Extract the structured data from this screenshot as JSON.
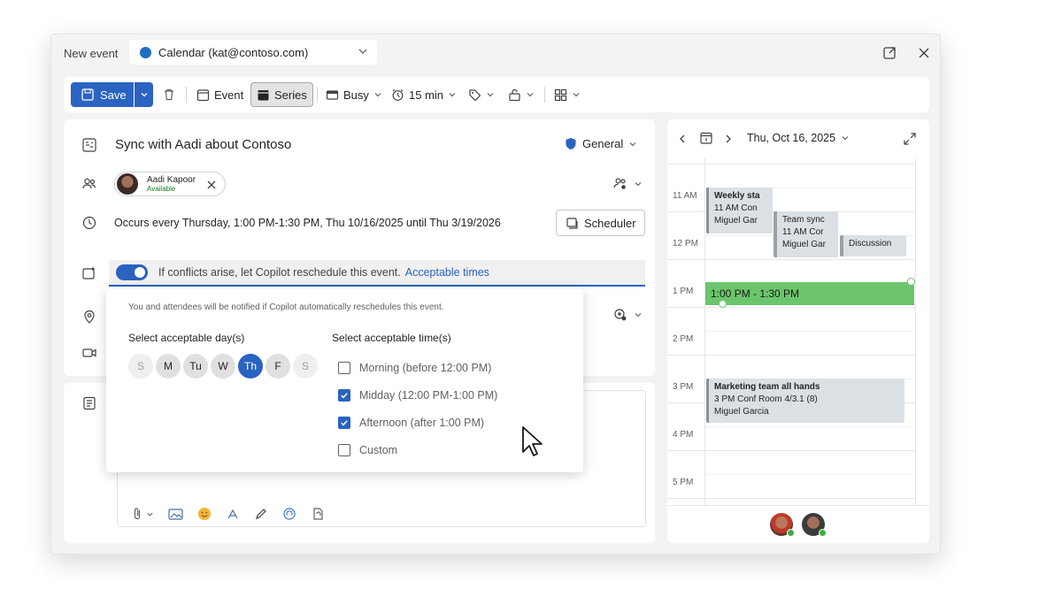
{
  "window": {
    "title": "New event",
    "calendar_account": "Calendar (kat@contoso.com)"
  },
  "toolbar": {
    "save_label": "Save",
    "event_label": "Event",
    "series_label": "Series",
    "show_as": "Busy",
    "reminder": "15 min"
  },
  "form": {
    "title": "Sync with Aadi about Contoso",
    "category": "General",
    "attendee": {
      "name": "Aadi Kapoor",
      "status": "Available"
    },
    "recurrence": "Occurs every Thursday, 1:00 PM-1:30 PM, Thu 10/16/2025 until Thu 3/19/2026",
    "scheduler_label": "Scheduler",
    "copilot_text": "If conflicts arise, let Copilot reschedule this event.",
    "copilot_link": "Acceptable times"
  },
  "popup": {
    "note": "You and attendees will be notified if Copilot automatically reschedules this event.",
    "days_heading": "Select acceptable day(s)",
    "times_heading": "Select acceptable time(s)",
    "days": [
      {
        "label": "S",
        "state": "off"
      },
      {
        "label": "M",
        "state": "on"
      },
      {
        "label": "Tu",
        "state": "on"
      },
      {
        "label": "W",
        "state": "on"
      },
      {
        "label": "Th",
        "state": "sel"
      },
      {
        "label": "F",
        "state": "on"
      },
      {
        "label": "S",
        "state": "off"
      }
    ],
    "times": [
      {
        "label": "Morning (before 12:00 PM)",
        "checked": false
      },
      {
        "label": "Midday (12:00 PM-1:00 PM)",
        "checked": true
      },
      {
        "label": "Afternoon (after 1:00 PM)",
        "checked": true
      },
      {
        "label": "Custom",
        "checked": false
      }
    ]
  },
  "calendar": {
    "date": "Thu, Oct 16, 2025",
    "hours": [
      "11 AM",
      "12 PM",
      "1 PM",
      "2 PM",
      "3 PM",
      "4 PM",
      "5 PM"
    ],
    "events": {
      "weekly": {
        "title": "Weekly sta",
        "line2": "11 AM Con",
        "line3": "Miguel Gar"
      },
      "team": {
        "title": "Team sync",
        "line2": "11 AM Cor",
        "line3": "Miguel Gar"
      },
      "discussion": {
        "title": "Discussion"
      },
      "current": {
        "title": "1:00 PM - 1:30 PM"
      },
      "marketing": {
        "title": "Marketing team all hands",
        "line2": "3 PM Conf Room 4/3.1 (8)",
        "line3": "Miguel Garcia"
      }
    }
  },
  "colors": {
    "accent": "#2a63c1",
    "current_event": "#6cc56c",
    "event_gray": "#dbe0e4",
    "available": "#107c10"
  }
}
